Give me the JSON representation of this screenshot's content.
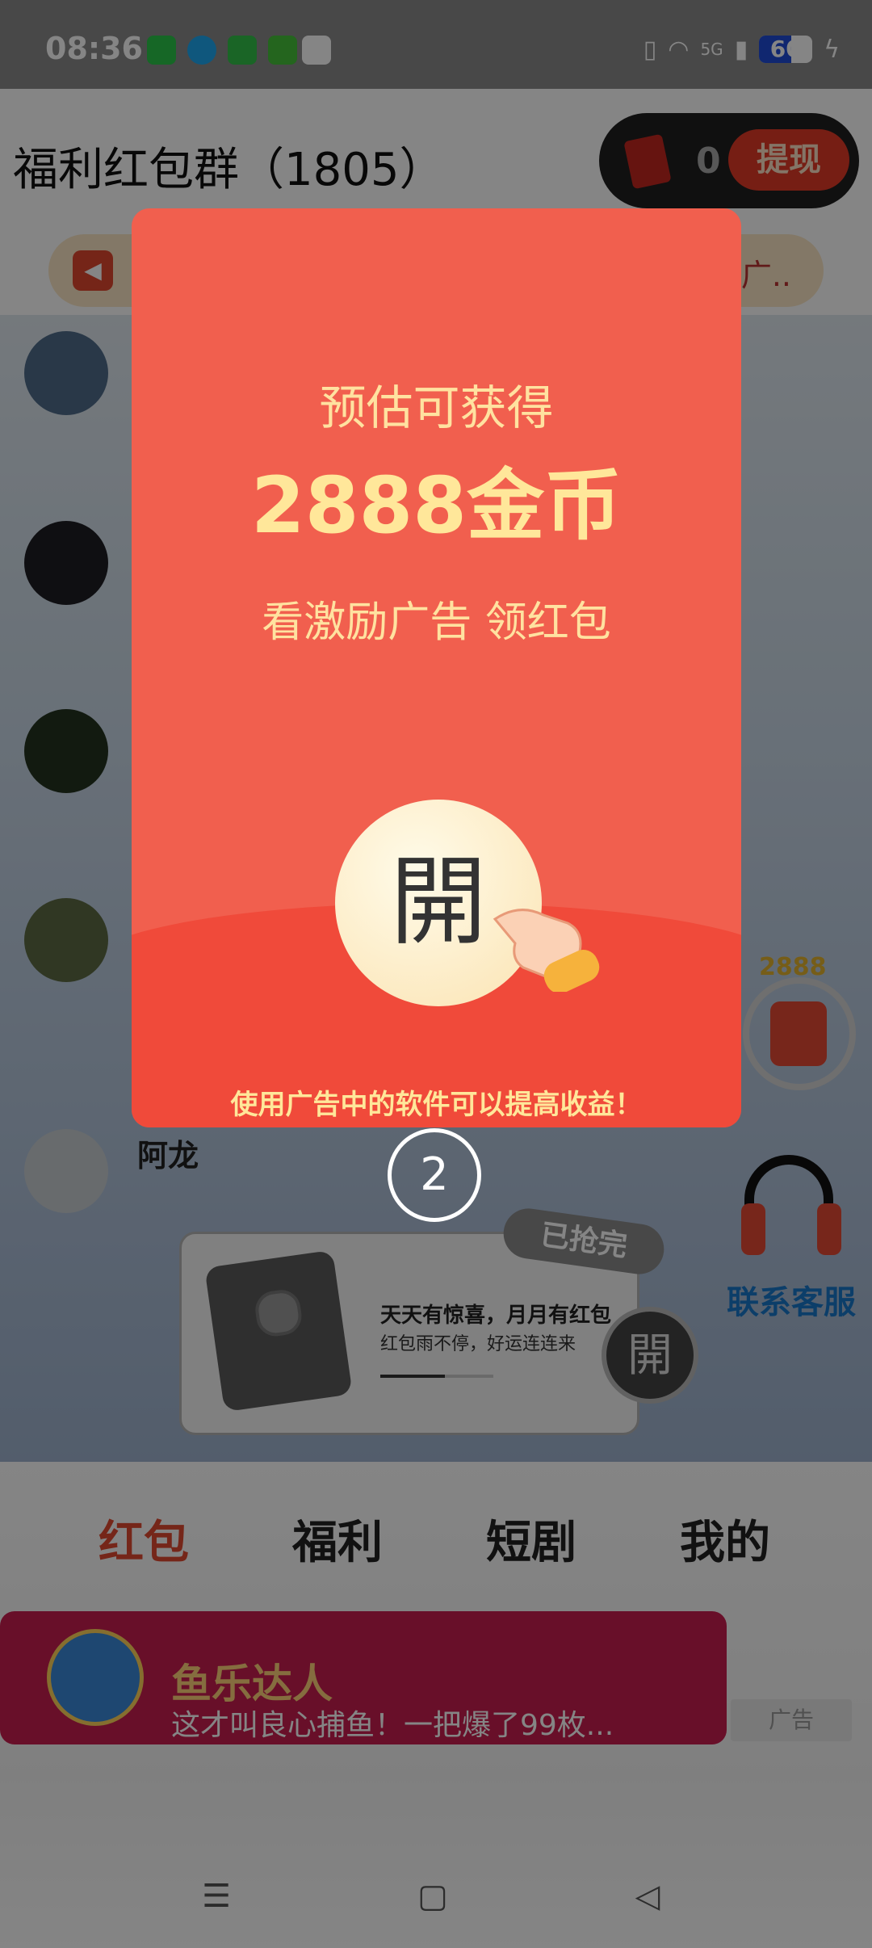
{
  "status_bar": {
    "time": "08:36",
    "network": "5G",
    "battery": "60"
  },
  "header": {
    "group_title": "福利红包群（1805）",
    "coin_count": "0",
    "withdraw_label": "提现"
  },
  "notice": {
    "text": "谨防别广.."
  },
  "chat": {
    "visible_name": "阿龙"
  },
  "floating": {
    "coin_badge": "2888",
    "service_label": "联系客服"
  },
  "red_packet_card": {
    "badge": "已抢完",
    "line1": "天天有惊喜，月月有红包",
    "line2": "红包雨不停，好运连连来",
    "open_label": "開"
  },
  "bottom_tabs": [
    "红包",
    "福利",
    "短剧",
    "我的"
  ],
  "ad_banner": {
    "title": "鱼乐达人",
    "subtitle": "这才叫良心捕鱼！一把爆了99枚...",
    "tag": "广告"
  },
  "popup": {
    "line1": "预估可获得",
    "amount": "2888金币",
    "line2": "看激励广告 领红包",
    "open_label": "開",
    "footer": "使用广告中的软件可以提高收益！"
  },
  "countdown": "2",
  "colors": {
    "popup_bg": "#f15f4e",
    "accent_text": "#ffe79a",
    "active_tab": "#e04a30"
  }
}
